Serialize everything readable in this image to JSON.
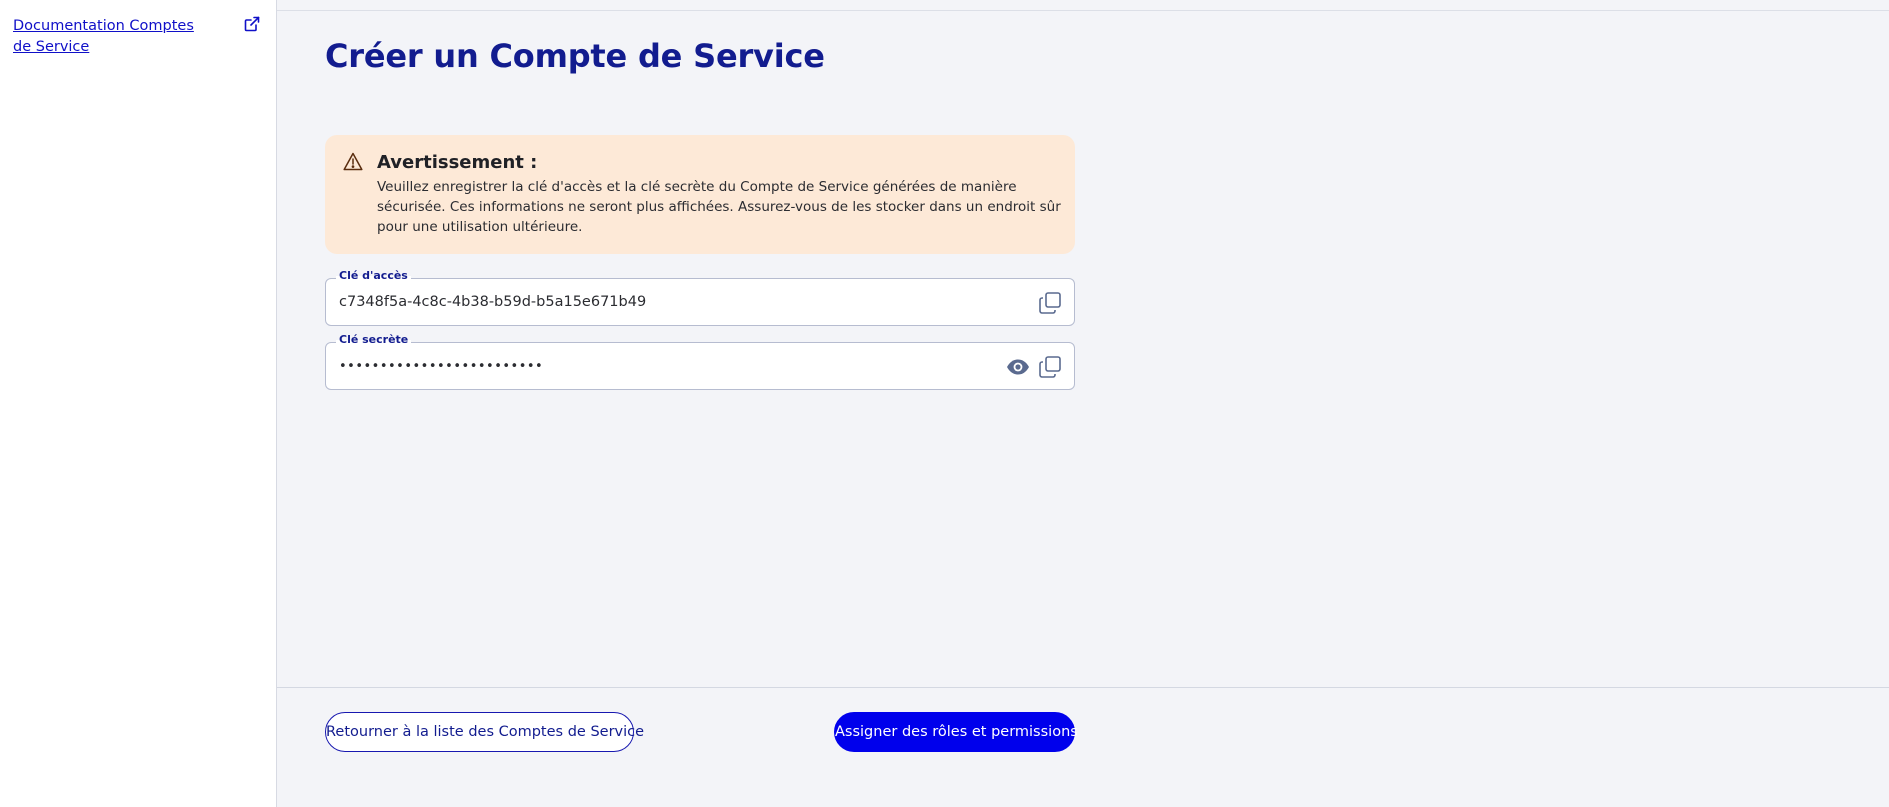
{
  "sidebar": {
    "doc_link": "Documentation Comptes de Service",
    "doc_link_icon": "external-link-icon"
  },
  "page": {
    "title": "Créer un Compte de Service"
  },
  "warning": {
    "icon": "warning-triangle-icon",
    "title": "Avertissement :",
    "text": "Veuillez enregistrer la clé d'accès et la clé secrète du Compte de Service générées de manière sécurisée. Ces informations ne seront plus affichées. Assurez-vous de les stocker dans un endroit sûr pour une utilisation ultérieure."
  },
  "access_key": {
    "label": "Clé d'accès",
    "value": "c7348f5a-4c8c-4b38-b59d-b5a15e671b49",
    "copy_icon": "copy-icon"
  },
  "secret_key": {
    "label": "Clé secrète",
    "value": "•••••••••••••••••••••••••",
    "show_icon": "eye-icon",
    "copy_icon": "copy-icon"
  },
  "footer": {
    "back_button": "Retourner à la liste des Comptes de Service",
    "assign_button": "Assigner des rôles et permissions"
  },
  "colors": {
    "brand": "#121c8f",
    "primary_button": "#0000ec",
    "warning_bg": "#fde9d7",
    "background": "#f3f4f8"
  }
}
